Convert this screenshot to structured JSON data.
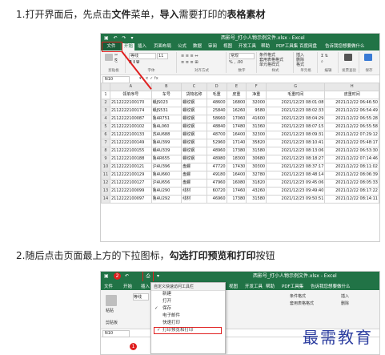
{
  "steps": {
    "step1_pre": "1.打开界面后，先点击",
    "step1_file": "文件",
    "step1_mid": "菜单，",
    "step1_import": "导入",
    "step1_mid2": "需要打印的",
    "step1_table": "表格素材",
    "step2_pre": "2.随后点击页面最上方的下拉图标，",
    "step2_bold": "勾选打印预览和打印",
    "step2_post": "按钮"
  },
  "excel1": {
    "title": "西影号_打小人物示例文件.xlsx - Excel",
    "menu": [
      "文件",
      "开始",
      "插入",
      "页面布局",
      "公式",
      "数据",
      "审阅",
      "视图",
      "开发工具",
      "帮助",
      "PDF工具集",
      "百度网盘"
    ],
    "tell_me": "告诉我您想要做什么",
    "ribbon_groups": [
      "剪贴板",
      "字体",
      "对齐方式",
      "数字",
      "样式",
      "单元格",
      "编辑",
      "发票查验",
      "保存"
    ],
    "font_name": "等线",
    "font_size": "11",
    "number_format": "常规",
    "style_items": [
      "条件格式",
      "套用表格格式",
      "单元格样式"
    ],
    "cell_items": [
      "插入",
      "删除",
      "格式"
    ],
    "namebox": "N10",
    "col_letters": [
      "A",
      "B",
      "C",
      "D",
      "E",
      "F",
      "G",
      "H"
    ],
    "headers": [
      "领单序号",
      "车号",
      "货物名称",
      "毛重",
      "皮重",
      "净重",
      "毛重时间",
      "皮重时间"
    ],
    "rows": [
      [
        "2112222100170",
        "赣JS023",
        "螺纹钢",
        "48600",
        "16800",
        "32000",
        "2021/12/23 08:01:08",
        "2021/12/22 06:46:50"
      ],
      [
        "2112222100174",
        "赣JS531",
        "螺纹钢",
        "25840",
        "16260",
        "9580",
        "2021/12/23 08:02:33",
        "2021/12/22 06:54:49"
      ],
      [
        "2112222100087",
        "鲁AR751",
        "螺纹钢",
        "58660",
        "17060",
        "41600",
        "2021/12/23 08:04:29",
        "2021/12/22 06:55:28"
      ],
      [
        "2112222100102",
        "鲁AL060",
        "螺纹钢",
        "48840",
        "17480",
        "31360",
        "2021/12/23 08:07:15",
        "2021/12/22 06:55:58"
      ],
      [
        "2112222100133",
        "苏AU688",
        "螺纹钢",
        "48700",
        "16400",
        "32300",
        "2021/12/23 08:09:31",
        "2021/12/22 07:29:12"
      ],
      [
        "2112222100149",
        "鲁AU399",
        "螺纹钢",
        "52960",
        "17140",
        "35820",
        "2021/12/23 08:10:41",
        "2021/12/22 05:48:17"
      ],
      [
        "2112222100155",
        "赣AU339",
        "螺纹钢",
        "48960",
        "17380",
        "31580",
        "2021/12/23 08:13:06",
        "2021/12/22 06:53:30"
      ],
      [
        "2112222100188",
        "鲁AR655",
        "螺纹钢",
        "48980",
        "18300",
        "30680",
        "2021/12/23 08:18:27",
        "2021/12/22 07:14:46"
      ],
      [
        "2112222100121",
        "沪AU396",
        "盘螺",
        "47720",
        "17430",
        "30300",
        "2021/12/23 08:37:17",
        "2021/12/22 08:11:02"
      ],
      [
        "2112222100129",
        "鲁AU660",
        "盘螺",
        "49180",
        "16400",
        "32780",
        "2021/12/23 08:48:14",
        "2021/12/22 08:06:39"
      ],
      [
        "2112222100127",
        "沪AU656",
        "盘螺",
        "47960",
        "16080",
        "31820",
        "2021/12/23 09:45:06",
        "2021/12/22 08:05:33"
      ],
      [
        "2112222100099",
        "鲁AU290",
        "线材",
        "60720",
        "17460",
        "43260",
        "2021/12/23 09:49:40",
        "2021/12/22 08:17:22"
      ],
      [
        "2112222100097",
        "鲁AU292",
        "线材",
        "46960",
        "17380",
        "31580",
        "2021/12/23 09:50:51",
        "2021/12/22 08:14:11"
      ]
    ]
  },
  "excel2": {
    "title": "西影号_打小人物示例文件.xlsx - Excel",
    "menu": [
      "文件",
      "开始",
      "插入",
      "页面布局",
      "公式",
      "数据",
      "审阅",
      "视图",
      "开发工具",
      "帮助",
      "PDF工具集"
    ],
    "tell_me": "告诉我您想要做什么",
    "dropdown_title": "自定义快速访问工具栏",
    "dropdown_items": [
      "新建",
      "打开",
      "保存",
      "电子邮件",
      "快速打印",
      "打印预览和打印"
    ],
    "checked": [
      false,
      false,
      true,
      false,
      false,
      true
    ],
    "namebox": "N10",
    "clipboard_label": "剪贴板",
    "paste_label": "粘贴",
    "font_name": "等线",
    "insert": "插入",
    "delete": "删除",
    "cond_format": "条件格式",
    "table_format": "套用表格格式",
    "badge1": "1",
    "badge2": "2"
  },
  "watermark": "最需教育",
  "colors": {
    "excel_green": "#217346",
    "highlight_red": "#e02020",
    "watermark_blue": "#2d3ea0"
  }
}
